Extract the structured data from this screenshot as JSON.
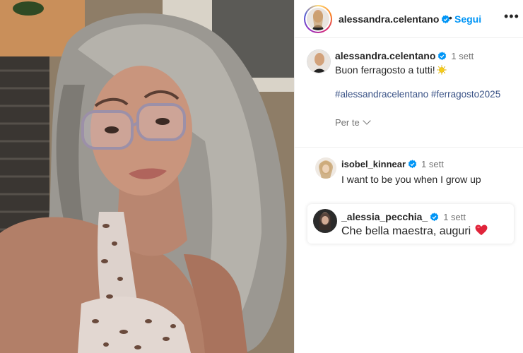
{
  "post": {
    "username": "alessandra.celentano",
    "follow_label": "Segui",
    "more_label": "•••",
    "dot": "•"
  },
  "caption": {
    "username": "alessandra.celentano",
    "time": "1 sett",
    "text": "Buon ferragosto a tutti!",
    "hashtags": [
      "#alessandracelentano",
      "#ferragosto2025"
    ],
    "for_you_label": "Per te"
  },
  "comments": [
    {
      "username": "isobel_kinnear",
      "time": "1 sett",
      "text": "I want to be you when I grow up"
    },
    {
      "username": "_alessia_pecchia_",
      "time": "1 sett",
      "text": "Che bella maestra, auguri"
    }
  ],
  "colors": {
    "link": "#0095f6",
    "hashtag": "#385185",
    "verified": "#0095f6",
    "heart": "#ed4956",
    "muted": "#737373"
  },
  "icons": [
    "verified-badge-icon",
    "sun-emoji-icon",
    "chevron-down-icon",
    "heart-emoji-icon",
    "more-options-icon"
  ]
}
